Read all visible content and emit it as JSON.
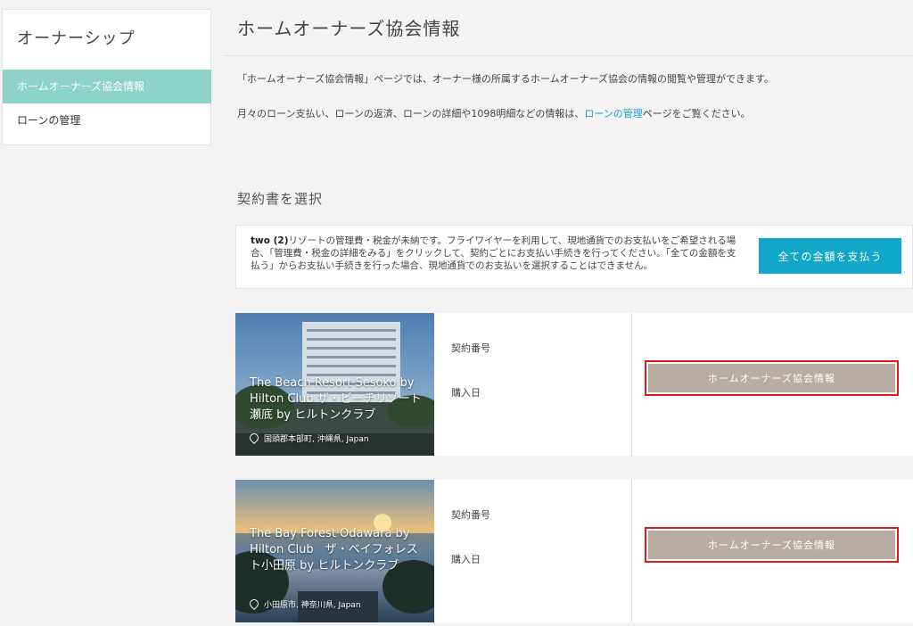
{
  "sidebar": {
    "title": "オーナーシップ",
    "items": [
      {
        "label": "ホームオーナーズ協会情報",
        "active": true
      },
      {
        "label": "ローンの管理",
        "active": false
      }
    ]
  },
  "page": {
    "title": "ホームオーナーズ協会情報",
    "intro1": "「ホームオーナーズ協会情報」ページでは、オーナー様の所属するホームオーナーズ協会の情報の閲覧や管理ができます。",
    "intro2_pre": "月々のローン支払い、ローンの返済、ローンの詳細や1098明細などの情報は、",
    "intro2_link": "ローンの管理",
    "intro2_post": "ページをご覧ください。",
    "section_title": "契約書を選択"
  },
  "notice": {
    "bold": "two (2)",
    "text": "リゾートの管理費・税金が未納です。フライワイヤーを利用して、現地通貨でのお支払いをご希望される場合、「管理費・税金の詳細をみる」をクリックして、契約ごとにお支払い手続きを行ってください。「全ての金額を支払う」からお支払い手続きを行った場合、現地通貨でのお支払いを選択することはできません。",
    "button_label": "全ての金額を支払う"
  },
  "contracts": [
    {
      "resort_name": "The Beach Resort Sesoko by Hilton Club ザ・ビーチリゾート瀬底 by ヒルトンクラブ",
      "location": "国頭郡本部町, 沖縄県, Japan",
      "contract_label": "契約番号",
      "purchase_label": "購入日",
      "button_label": "ホームオーナーズ協会情報"
    },
    {
      "resort_name": "The Bay Forest Odawara by Hilton Club　ザ・ベイフォレスト小田原 by ヒルトンクラブ",
      "location": "小田原市, 神奈川県, Japan",
      "contract_label": "契約番号",
      "purchase_label": "購入日",
      "button_label": "ホームオーナーズ協会情報"
    }
  ],
  "colors": {
    "accent": "#8dd3c7",
    "pay_button": "#10a7c9",
    "hoa_button": "#b7ada2",
    "highlight": "#e31919",
    "link": "#1a9bd7"
  }
}
